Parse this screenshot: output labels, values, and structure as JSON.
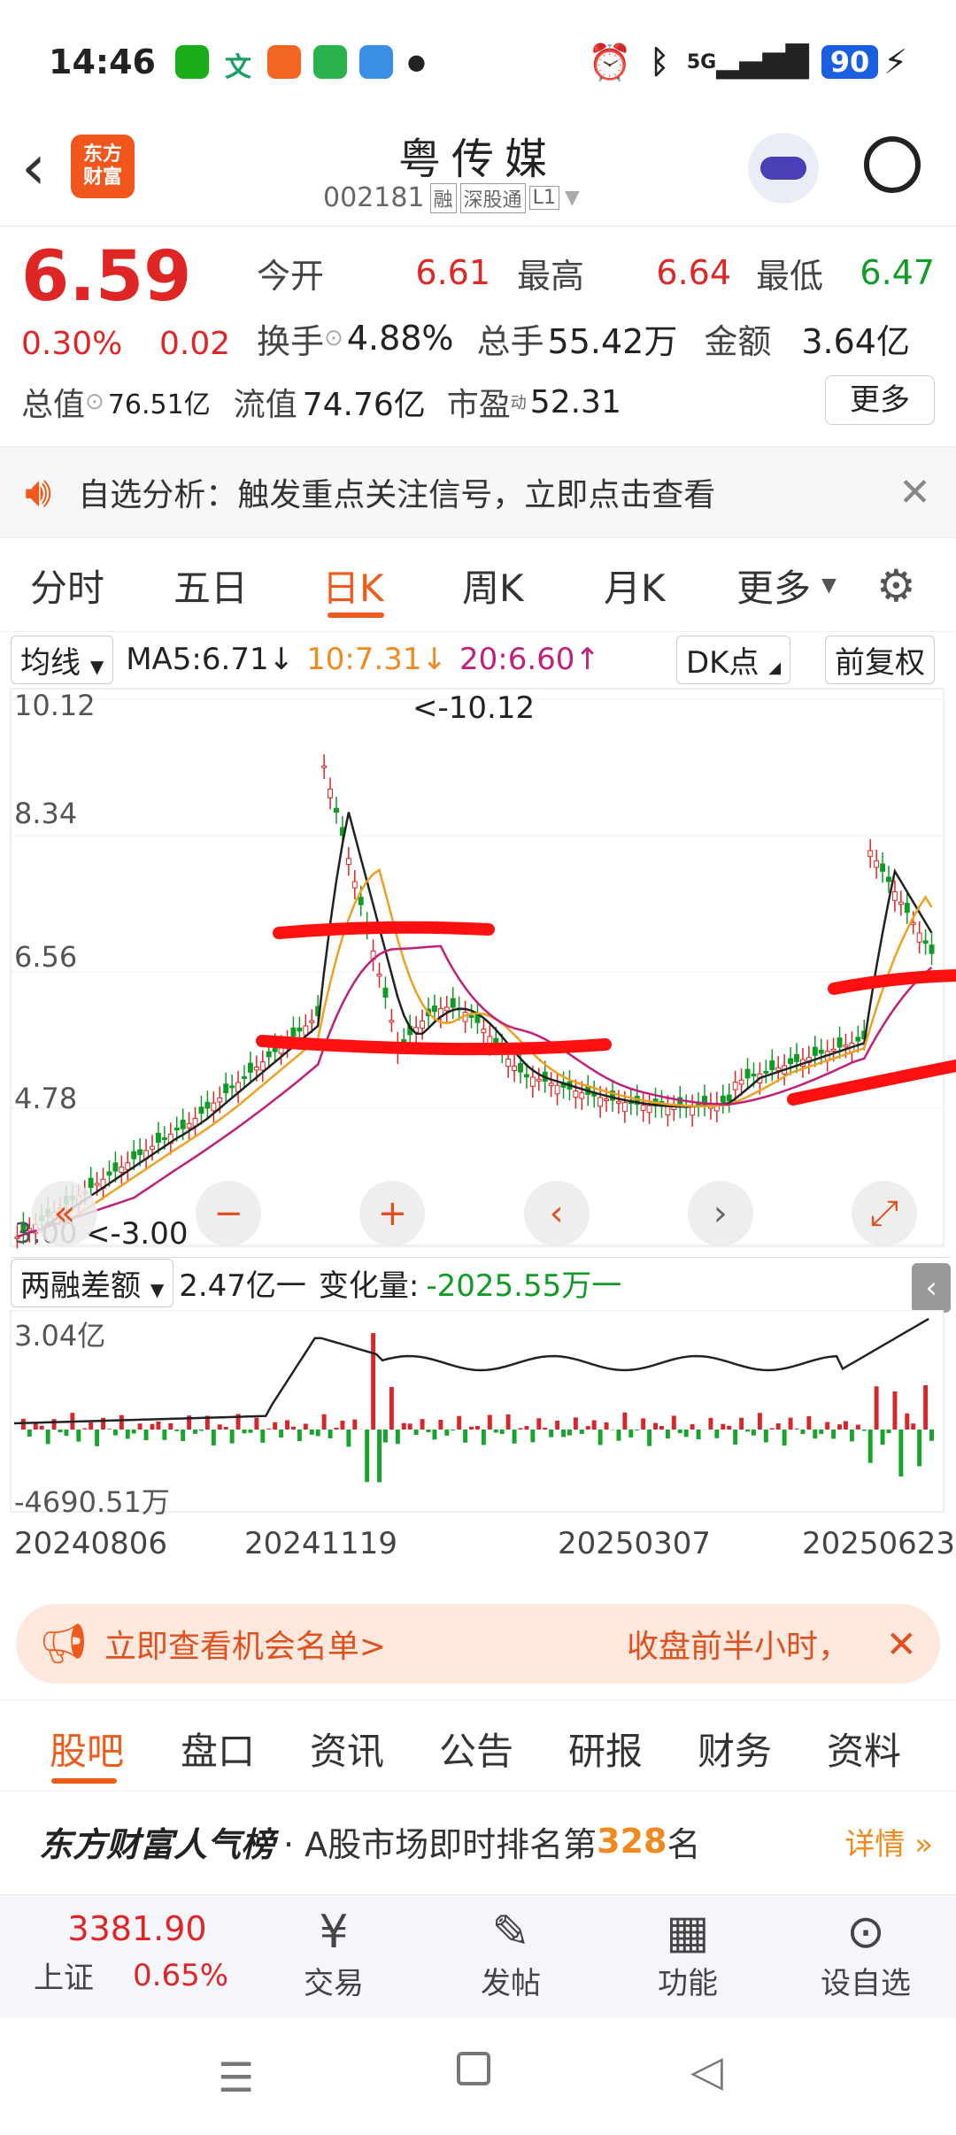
{
  "status": {
    "time": "14:46",
    "battery": "90",
    "network": "5G"
  },
  "header": {
    "name": "粤传媒",
    "code": "002181",
    "tags": [
      "融",
      "深股通",
      "L1"
    ],
    "logo": "东方\n财富"
  },
  "quote": {
    "price": "6.59",
    "pct": "0.30%",
    "chg": "0.02",
    "open_l": "今开",
    "open": "6.61",
    "high_l": "最高",
    "high": "6.64",
    "low_l": "最低",
    "low": "6.47",
    "turn_l": "换手",
    "turn": "4.88%",
    "vol_l": "总手",
    "vol": "55.42万",
    "amt_l": "金额",
    "amt": "3.64亿",
    "mcap_l": "总值",
    "mcap": "76.51亿",
    "fcap_l": "流值",
    "fcap": "74.76亿",
    "pe_l": "市盈",
    "pe_sup": "动",
    "pe": "52.31",
    "more": "更多"
  },
  "notice": {
    "text": "自选分析：触发重点关注信号，立即点击查看"
  },
  "ktabs": [
    "分时",
    "五日",
    "日K",
    "周K",
    "月K",
    "更多"
  ],
  "ma": {
    "sel": "均线",
    "ma5": "MA5:6.71↓",
    "ma10": "10:7.31↓",
    "ma20": "20:6.60↑",
    "dk": "DK点",
    "fq": "前复权"
  },
  "chart_data": [
    {
      "type": "candlestick",
      "yticks": [
        "10.12",
        "8.34",
        "6.56",
        "4.78",
        "3.00"
      ],
      "max_label": "<-10.12",
      "min_label": "<-3.00",
      "ylim": [
        3.0,
        10.12
      ],
      "series": [
        {
          "name": "MA5",
          "color": "#222222"
        },
        {
          "name": "10",
          "color": "#f0a020"
        },
        {
          "name": "20",
          "color": "#c0207a"
        }
      ]
    },
    {
      "type": "bar",
      "title": "两融差额",
      "value": "2.47亿一",
      "change_l": "变化量:",
      "change": "-2025.55万一",
      "yticks": [
        "3.04亿",
        "-4690.51万"
      ],
      "ylim": [
        -0.469,
        3.04
      ],
      "xticks": [
        "20240806",
        "20241119",
        "20250307",
        "20250623"
      ]
    }
  ],
  "banner": {
    "left": "立即查看机会名单>",
    "right": "收盘前半小时，"
  },
  "subtabs": [
    "股吧",
    "盘口",
    "资讯",
    "公告",
    "研报",
    "财务",
    "资料"
  ],
  "rank": {
    "brand": "东方财富人气榜",
    "text": "· A股市场即时排名第",
    "num": "328",
    "unit": "名",
    "more": "详情"
  },
  "bottom": {
    "index_val": "3381.90",
    "index_name": "上证",
    "index_pct": "0.65%",
    "items": [
      "交易",
      "发帖",
      "功能",
      "设自选"
    ]
  }
}
